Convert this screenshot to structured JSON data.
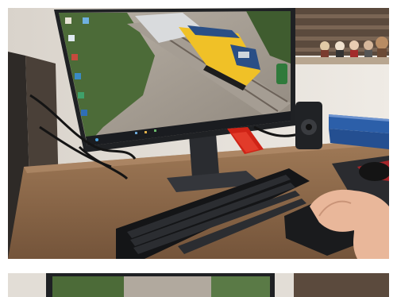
{
  "scene": {
    "colors": {
      "wall": "#e7e2db",
      "desk": "#8d6a4b",
      "monitor": "#1f2124",
      "locomotive": "#f0c127",
      "loco_blue": "#2a4f86",
      "keyboard": "#141517",
      "hand": "#e9b79a",
      "stapler": "#cf2316",
      "books": "#2c5fa9",
      "tree": "#4c6b38",
      "shelf": "#b8a690",
      "mousepad": "#2a2b2f"
    },
    "photos": 2
  }
}
